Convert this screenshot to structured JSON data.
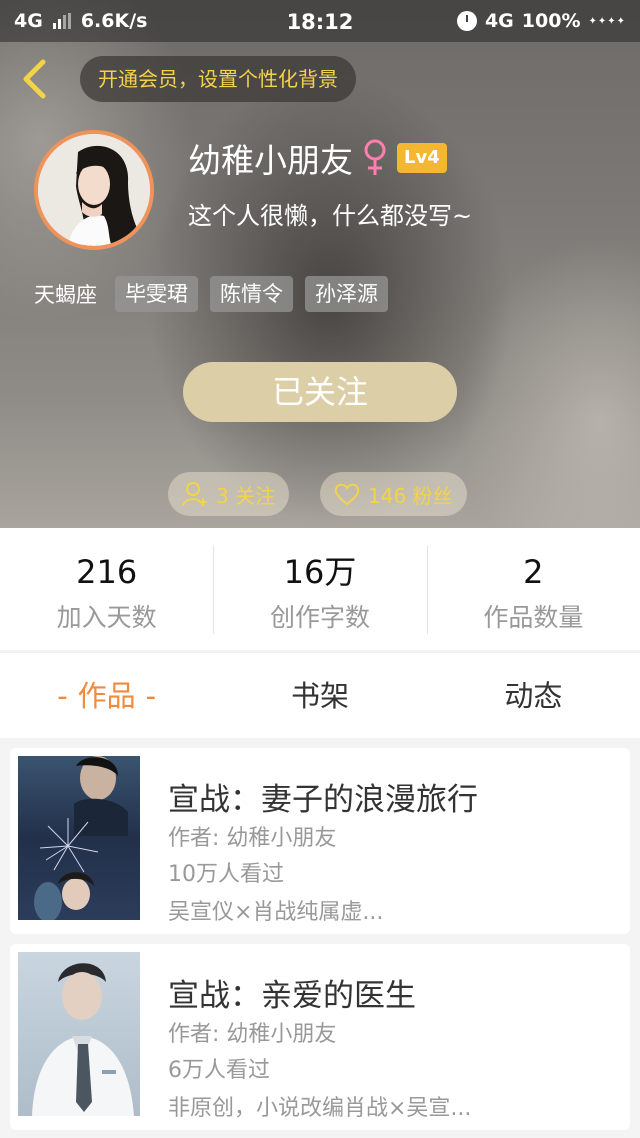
{
  "status_bar": {
    "network_left": "4G",
    "speed": "6.6K/s",
    "time": "18:12",
    "network_right": "4G",
    "battery": "100%"
  },
  "header": {
    "vip_banner": "开通会员，设置个性化背景",
    "username": "幼稚小朋友",
    "gender_icon": "female-icon",
    "level": "Lv4",
    "signature": "这个人很懒，什么都没写~",
    "zodiac": "天蝎座",
    "tags": [
      "毕雯珺",
      "陈情令",
      "孙泽源"
    ],
    "follow_button": "已关注",
    "following_label": "3 关注",
    "fans_label": "146 粉丝"
  },
  "stats": [
    {
      "value": "216",
      "label": "加入天数"
    },
    {
      "value": "16万",
      "label": "创作字数"
    },
    {
      "value": "2",
      "label": "作品数量"
    }
  ],
  "tabs": [
    {
      "label": "作品",
      "active": true
    },
    {
      "label": "书架",
      "active": false
    },
    {
      "label": "动态",
      "active": false
    }
  ],
  "works": [
    {
      "title": "宣战：妻子的浪漫旅行",
      "author": "作者: 幼稚小朋友",
      "views": "10万人看过",
      "desc": "吴宣仪×肖战纯属虚..."
    },
    {
      "title": "宣战：亲爱的医生",
      "author": "作者: 幼稚小朋友",
      "views": "6万人看过",
      "desc": "非原创，小说改编肖战×吴宣..."
    }
  ],
  "colors": {
    "accent": "#f08a3e",
    "gold": "#f2d34a",
    "level_badge": "#f5b731",
    "follow_button": "#dccfa7"
  }
}
